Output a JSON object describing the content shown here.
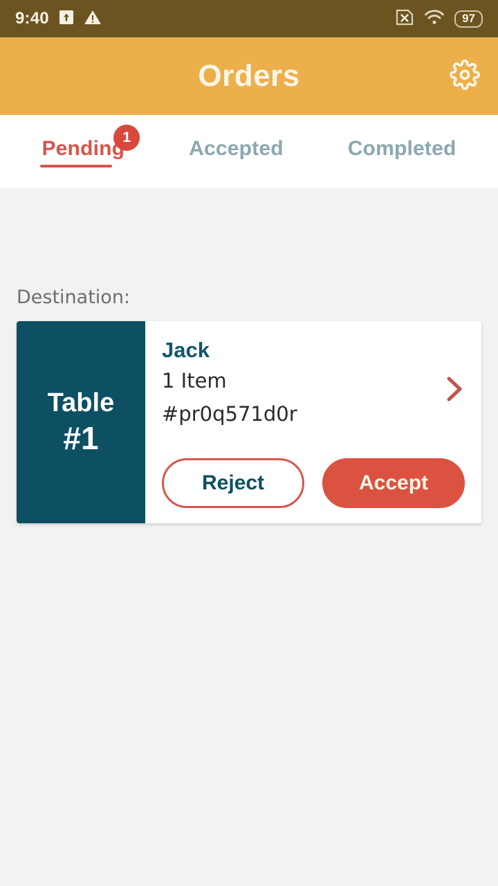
{
  "status_bar": {
    "time": "9:40",
    "icons": [
      "upload-box-icon",
      "warning-triangle-icon",
      "no-sim-icon",
      "wifi-icon"
    ],
    "battery_level": "97",
    "background_color": "#6B5420"
  },
  "app_bar": {
    "title": "Orders",
    "settings_icon": "gear-icon",
    "background_color": "#EDAF4A",
    "title_color": "#FCF6E8"
  },
  "tabs": {
    "items": [
      {
        "label": "Pending",
        "active": true,
        "badge": "1"
      },
      {
        "label": "Accepted",
        "active": false,
        "badge": ""
      },
      {
        "label": "Completed",
        "active": false,
        "badge": ""
      }
    ],
    "active_color": "#D9544A",
    "inactive_color": "#8BA8AE",
    "badge_color": "#D9483C"
  },
  "main": {
    "destination_label": "Destination:",
    "order": {
      "table_word": "Table",
      "table_number": "#1",
      "customer_name": "Jack",
      "item_count": "1 Item",
      "order_id": "#pr0q571d0r",
      "chevron_icon": "chevron-right-icon",
      "reject_label": "Reject",
      "accept_label": "Accept",
      "panel_color": "#0D4F63",
      "accept_color": "#DB5240"
    }
  }
}
